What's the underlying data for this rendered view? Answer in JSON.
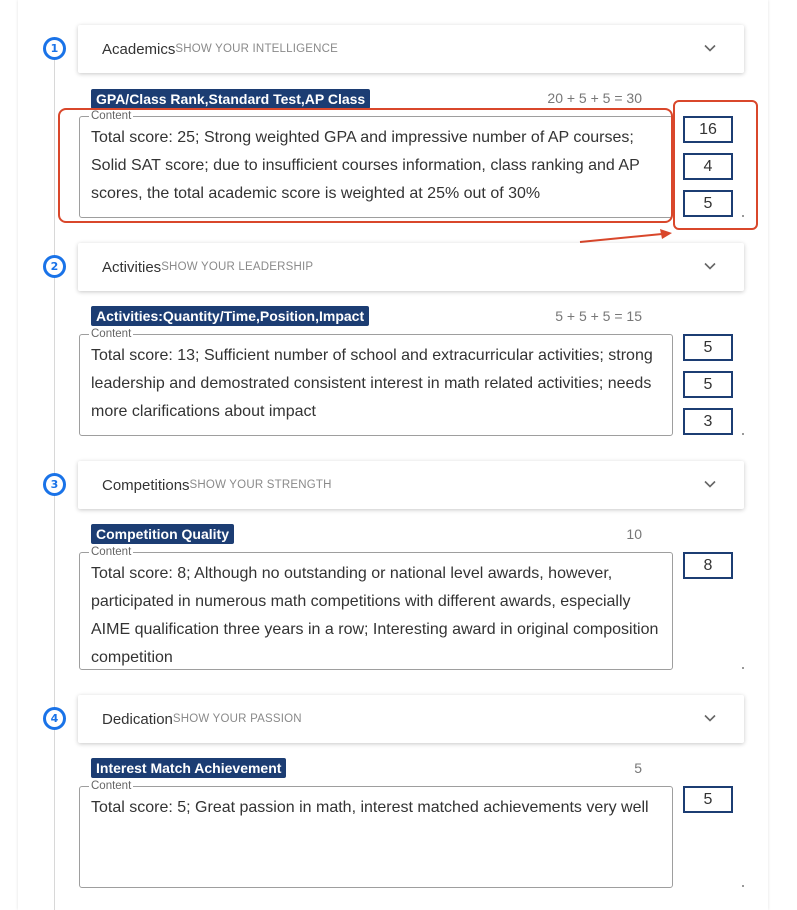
{
  "sections": [
    {
      "number": "1",
      "title": "Academics",
      "subtitle": "SHOW YOUR INTELLIGENCE",
      "tag": "GPA/Class Rank,Standard Test,AP Class",
      "formula": "20 + 5 + 5 = 30",
      "content_label": "Content",
      "content": "Total score: 25; Strong weighted GPA and impressive number of AP courses; Solid SAT score; due to insufficient courses information, class ranking and AP scores, the total academic score is weighted at 25% out of 30%",
      "scores": [
        "16",
        "4",
        "5"
      ]
    },
    {
      "number": "2",
      "title": "Activities",
      "subtitle": "SHOW YOUR LEADERSHIP",
      "tag": "Activities:Quantity/Time,Position,Impact",
      "formula": "5 + 5 + 5 = 15",
      "content_label": "Content",
      "content": "Total score: 13; Sufficient number of school and extracurricular activities; strong leadership and demostrated consistent interest in math related activities; needs more clarifications about impact",
      "scores": [
        "5",
        "5",
        "3"
      ]
    },
    {
      "number": "3",
      "title": "Competitions",
      "subtitle": "SHOW YOUR STRENGTH",
      "tag": "Competition Quality",
      "formula": "10",
      "content_label": "Content",
      "content": "Total score: 8; Although no outstanding or national level awards, however, participated in numerous math competitions with different awards, especially AIME qualification three years in a row; Interesting award in original composition competition",
      "scores": [
        "8"
      ]
    },
    {
      "number": "4",
      "title": "Dedication",
      "subtitle": "SHOW YOUR PASSION",
      "tag": "Interest Match Achievement",
      "formula": "5",
      "content_label": "Content",
      "content": "Total score: 5; Great passion in math, interest matched achievements very well",
      "scores": [
        "5"
      ]
    }
  ],
  "icons": {
    "expand": "chevron-down-icon",
    "annotation_arrow": "arrow-right-icon"
  },
  "colors": {
    "accent": "#1a73e8",
    "tag_bg": "#1c3d73",
    "annotation": "#d9472b"
  }
}
